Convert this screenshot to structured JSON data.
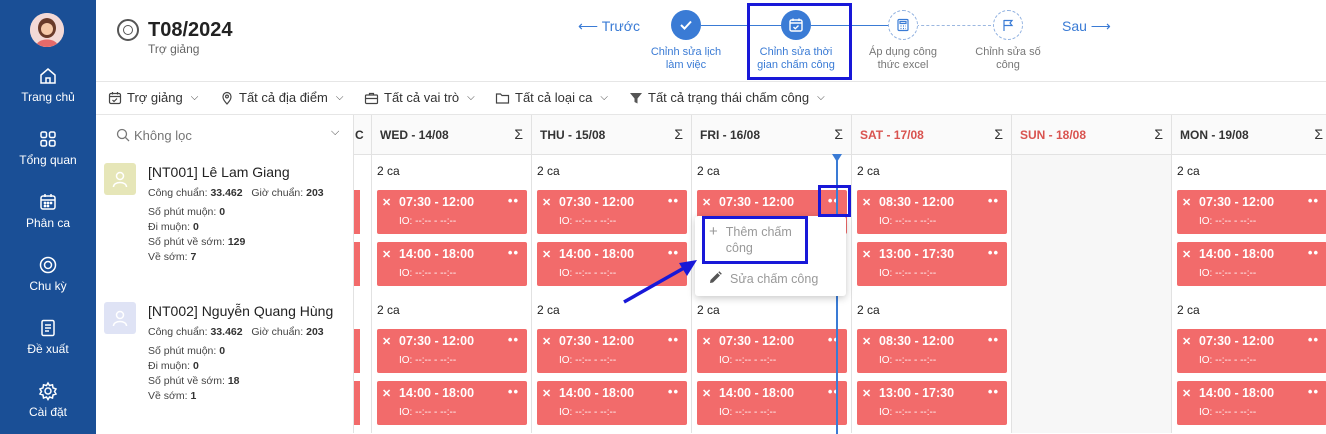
{
  "sidebar": {
    "items": [
      {
        "label": "Trang chủ",
        "icon": "home-icon"
      },
      {
        "label": "Tổng quan",
        "icon": "grid-icon"
      },
      {
        "label": "Phân ca",
        "icon": "calendar-icon"
      },
      {
        "label": "Chu kỳ",
        "icon": "cycle-icon"
      },
      {
        "label": "Đề xuất",
        "icon": "document-icon"
      },
      {
        "label": "Cài đặt",
        "icon": "gear-icon"
      }
    ]
  },
  "header": {
    "title": "T08/2024",
    "subtitle": "Trợ giảng",
    "prev": "⟵ Trước",
    "next": "Sau ⟶",
    "steps": [
      {
        "line1": "Chỉnh sửa lịch",
        "line2": "làm việc",
        "state": "done"
      },
      {
        "line1": "Chỉnh sửa thời",
        "line2": "gian chấm công",
        "state": "active"
      },
      {
        "line1": "Áp dụng công",
        "line2": "thức excel",
        "state": "pending"
      },
      {
        "line1": "Chỉnh sửa số",
        "line2": "công",
        "state": "pending"
      }
    ]
  },
  "filters": [
    {
      "label": "Trợ giảng",
      "icon": "calendar-check-icon"
    },
    {
      "label": "Tất cả địa điểm",
      "icon": "location-pin-icon"
    },
    {
      "label": "Tất cả vai trò",
      "icon": "briefcase-icon"
    },
    {
      "label": "Tất cả loại ca",
      "icon": "folder-icon"
    },
    {
      "label": "Tất cả trạng thái chấm công",
      "icon": "filter-icon"
    }
  ],
  "search": {
    "placeholder": "Không lọc"
  },
  "partial_day_label": "C",
  "days": [
    {
      "label": "WED - 14/08",
      "weekend": false
    },
    {
      "label": "THU - 15/08",
      "weekend": false
    },
    {
      "label": "FRI - 16/08",
      "weekend": false
    },
    {
      "label": "SAT - 17/08",
      "weekend": true
    },
    {
      "label": "SUN - 18/08",
      "weekend": true
    },
    {
      "label": "MON - 19/08",
      "weekend": false
    }
  ],
  "sigma": "Σ",
  "io_text": "IO: --:-- - --:--",
  "employees": [
    {
      "name": "[NT001] Lê Lam Giang",
      "cong_chuan_label": "Công chuẩn:",
      "cong_chuan": "33.462",
      "gio_chuan_label": "Giờ chuẩn:",
      "gio_chuan": "203",
      "phut_muon_label": "Số phút muộn:",
      "phut_muon": "0",
      "di_muon_label": "Đi muộn:",
      "di_muon": "0",
      "phut_ve_som_label": "Số phút về sớm:",
      "phut_ve_som": "129",
      "ve_som_label": "Về sớm:",
      "ve_som": "7",
      "avatar_color": "#e6e6b8",
      "cells": [
        {
          "count": "2 ca",
          "shifts": [
            "07:30 - 12:00",
            "14:00 - 18:00"
          ]
        },
        {
          "count": "2 ca",
          "shifts": [
            "07:30 - 12:00",
            "14:00 - 18:00"
          ]
        },
        {
          "count": "2 ca",
          "shifts": [
            "07:30 - 12:00"
          ]
        },
        {
          "count": "2 ca",
          "shifts": [
            "08:30 - 12:00",
            "13:00 - 17:30"
          ]
        },
        {
          "count": "",
          "shifts": []
        },
        {
          "count": "2 ca",
          "shifts": [
            "07:30 - 12:00",
            "14:00 - 18:00"
          ]
        }
      ]
    },
    {
      "name": "[NT002] Nguyễn Quang Hùng",
      "cong_chuan_label": "Công chuẩn:",
      "cong_chuan": "33.462",
      "gio_chuan_label": "Giờ chuẩn:",
      "gio_chuan": "203",
      "phut_muon_label": "Số phút muộn:",
      "phut_muon": "0",
      "di_muon_label": "Đi muộn:",
      "di_muon": "0",
      "phut_ve_som_label": "Số phút về sớm:",
      "phut_ve_som": "18",
      "ve_som_label": "Về sớm:",
      "ve_som": "1",
      "avatar_color": "#dfe3f5",
      "cells": [
        {
          "count": "2 ca",
          "shifts": [
            "07:30 - 12:00",
            "14:00 - 18:00"
          ]
        },
        {
          "count": "2 ca",
          "shifts": [
            "07:30 - 12:00",
            "14:00 - 18:00"
          ]
        },
        {
          "count": "2 ca",
          "shifts": [
            "07:30 - 12:00",
            "14:00 - 18:00"
          ]
        },
        {
          "count": "2 ca",
          "shifts": [
            "08:30 - 12:00",
            "13:00 - 17:30"
          ]
        },
        {
          "count": "",
          "shifts": []
        },
        {
          "count": "2 ca",
          "shifts": [
            "07:30 - 12:00",
            "14:00 - 18:00"
          ]
        }
      ]
    }
  ],
  "popup": {
    "add_icon": "+",
    "add_line1": "Thêm chấm",
    "add_line2": "công",
    "edit_label": "Sửa chấm công"
  },
  "colors": {
    "sidebar": "#1a4f96",
    "accent": "#3a7bd5",
    "shift": "#f26b6b",
    "highlight": "#1818d8"
  }
}
